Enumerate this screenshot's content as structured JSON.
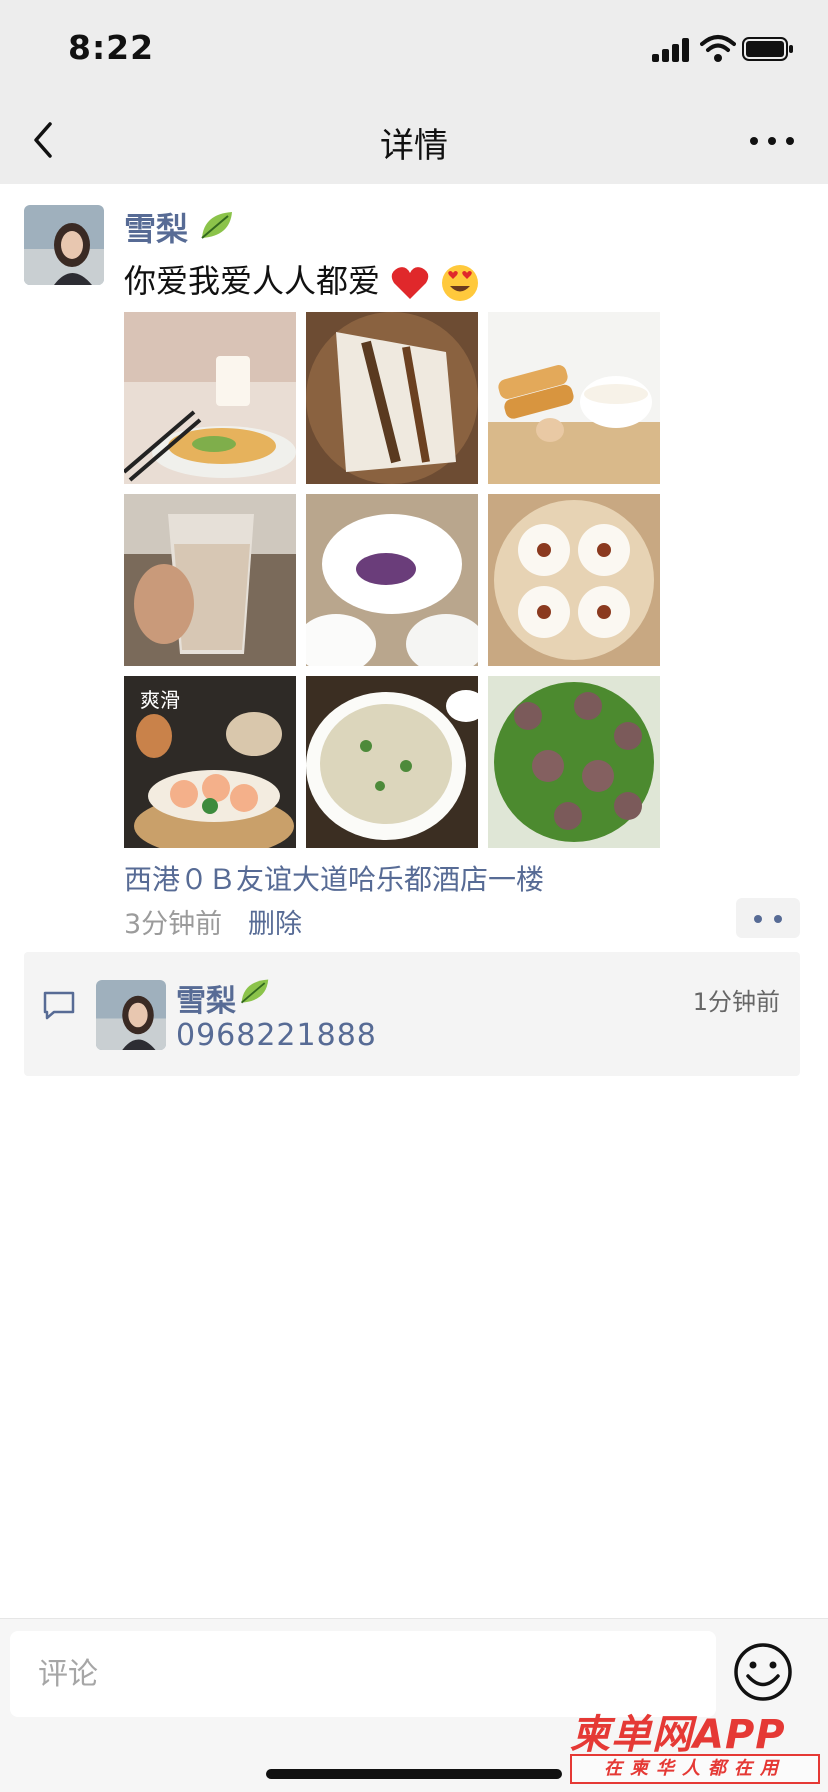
{
  "status_bar": {
    "time": "8:22"
  },
  "nav": {
    "title": "详情"
  },
  "post": {
    "author": "雪梨",
    "text": "你爱我爱人人都爱",
    "emojis": [
      "red-heart",
      "heart-eyes-face"
    ],
    "photos": [
      {
        "subject": "milk-and-pancake-breakfast"
      },
      {
        "subject": "rice-noodle-roll"
      },
      {
        "subject": "fried-dough-and-soy-milk"
      },
      {
        "subject": "cup-of-milk-tea"
      },
      {
        "subject": "purple-sweet-potato-bun"
      },
      {
        "subject": "steamed-char-siu-buns"
      },
      {
        "subject": "shrimp-dumplings",
        "caption": "爽滑"
      },
      {
        "subject": "congee-bowl"
      },
      {
        "subject": "meatball-soup-with-greens"
      }
    ],
    "location": "西港０Ｂ友谊大道哈乐都酒店一楼",
    "time_ago": "3分钟前",
    "delete_label": "删除"
  },
  "comments": [
    {
      "author": "雪梨",
      "time": "1分钟前",
      "text": "0968221888"
    }
  ],
  "bottom": {
    "comment_placeholder": "评论"
  },
  "watermark": {
    "title": "柬单网APP",
    "subtitle": "在柬华人都在用"
  },
  "colors": {
    "link": "#576b95",
    "nav_bg": "#ededed",
    "accent_red": "#e53935"
  }
}
